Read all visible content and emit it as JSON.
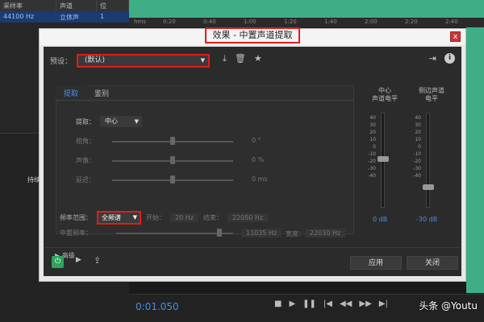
{
  "background": {
    "table_headers": [
      "采样率",
      "声道",
      "位"
    ],
    "table_row": [
      "44100 Hz",
      "立体声",
      "1"
    ],
    "left_label": "持续",
    "ruler_label": "hms",
    "ruler_ticks": [
      "0:20",
      "0:40",
      "1:00",
      "1:20",
      "1:40",
      "2:00",
      "2:20",
      "2:40"
    ],
    "timecode": "0:01.050",
    "watermark": "头条 @Youtu"
  },
  "dialog": {
    "title": "效果 - 中置声道提取",
    "close_label": "x",
    "preset_label": "预设：",
    "preset_value": "(默认)",
    "tabs": [
      {
        "label": "提取"
      },
      {
        "label": "鉴别"
      }
    ],
    "extract_label": "提取：",
    "extract_value": "中心",
    "phase_label": "相角：",
    "phase_value": "0 °",
    "sound_label": "声像：",
    "sound_value": "0 %",
    "delay_label": "延迟：",
    "delay_value": "0 ms",
    "freq_range_label": "频率范围：",
    "freq_range_value": "全频谱",
    "start_label": "开始：",
    "start_value": "20 Hz",
    "end_label": "结束：",
    "end_value": "22050 Hz",
    "center_freq_label": "中置频率：",
    "center_freq_value": "11035 Hz",
    "width_label": "宽度：",
    "width_value": "22030 Hz",
    "advanced_label": "高级",
    "meter_center_label": "中心\n声道电平",
    "meter_side_label": "侧边声道\n电平",
    "meter_scale": [
      "40",
      "30",
      "20",
      "10",
      "0",
      "-10",
      "-20",
      "-30",
      "-40"
    ],
    "meter_center_value": "0 dB",
    "meter_side_value": "-30 dB",
    "apply_label": "应用",
    "close_button_label": "关闭"
  },
  "colors": {
    "accent": "#4a8de0",
    "highlight": "#e21b1b",
    "power": "#2fa35a",
    "waveform": "#3fae87"
  }
}
